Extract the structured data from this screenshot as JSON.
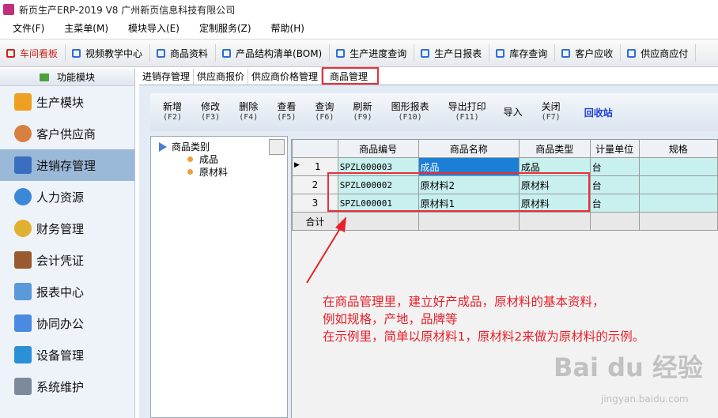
{
  "window": {
    "title": "新页生产ERP-2019 V8 广州新页信息科技有限公司"
  },
  "menu": [
    "文件(F)",
    "主菜单(M)",
    "模块导入(E)",
    "定制服务(Z)",
    "帮助(H)"
  ],
  "quickbar": [
    "车间看板",
    "视频教学中心",
    "商品资料",
    "产品结构清单(BOM)",
    "生产进度查询",
    "生产日报表",
    "库存查询",
    "客户应收",
    "供应商应付"
  ],
  "sidebar": {
    "header": "功能模块",
    "items": [
      "生产模块",
      "客户供应商",
      "进销存管理",
      "人力资源",
      "财务管理",
      "会计凭证",
      "报表中心",
      "协同办公",
      "设备管理",
      "系统维护"
    ]
  },
  "tabs": [
    "进销存管理",
    "供应商报价",
    "供应商价格管理",
    "商品管理"
  ],
  "toolbar": [
    {
      "label": "新增",
      "key": "(F2)"
    },
    {
      "label": "修改",
      "key": "(F3)"
    },
    {
      "label": "删除",
      "key": "(F4)"
    },
    {
      "label": "查看",
      "key": "(F5)"
    },
    {
      "label": "查询",
      "key": "(F6)"
    },
    {
      "label": "刷新",
      "key": "(F9)"
    },
    {
      "label": "图形报表",
      "key": "(F10)"
    },
    {
      "label": "导出打印",
      "key": "(F11)"
    },
    {
      "label": "导入",
      "key": ""
    },
    {
      "label": "关闭",
      "key": "(F7)"
    },
    {
      "label": "回收站",
      "key": ""
    }
  ],
  "tree": {
    "root": "商品类别",
    "children": [
      "成品",
      "原材料"
    ]
  },
  "grid": {
    "columns": [
      "商品编号",
      "商品名称",
      "商品类型",
      "计量单位",
      "规格"
    ],
    "rows": [
      {
        "no": "1",
        "code": "SPZL000003",
        "name": "成品",
        "type": "成品",
        "unit": "台",
        "spec": ""
      },
      {
        "no": "2",
        "code": "SPZL000002",
        "name": "原材料2",
        "type": "原材料",
        "unit": "台",
        "spec": ""
      },
      {
        "no": "3",
        "code": "SPZL000001",
        "name": "原材料1",
        "type": "原材料",
        "unit": "台",
        "spec": ""
      }
    ],
    "sum_label": "合计"
  },
  "annotation": {
    "line1": "在商品管理里，建立好产成品，原材料的基本资料，",
    "line2": "例如规格，产地，品牌等",
    "line3": "在示例里，简单以原材料1，原材料2来做为原材料的示例。"
  },
  "watermark": {
    "brand": "Bai du 经验",
    "url": "jingyan.baidu.com"
  }
}
